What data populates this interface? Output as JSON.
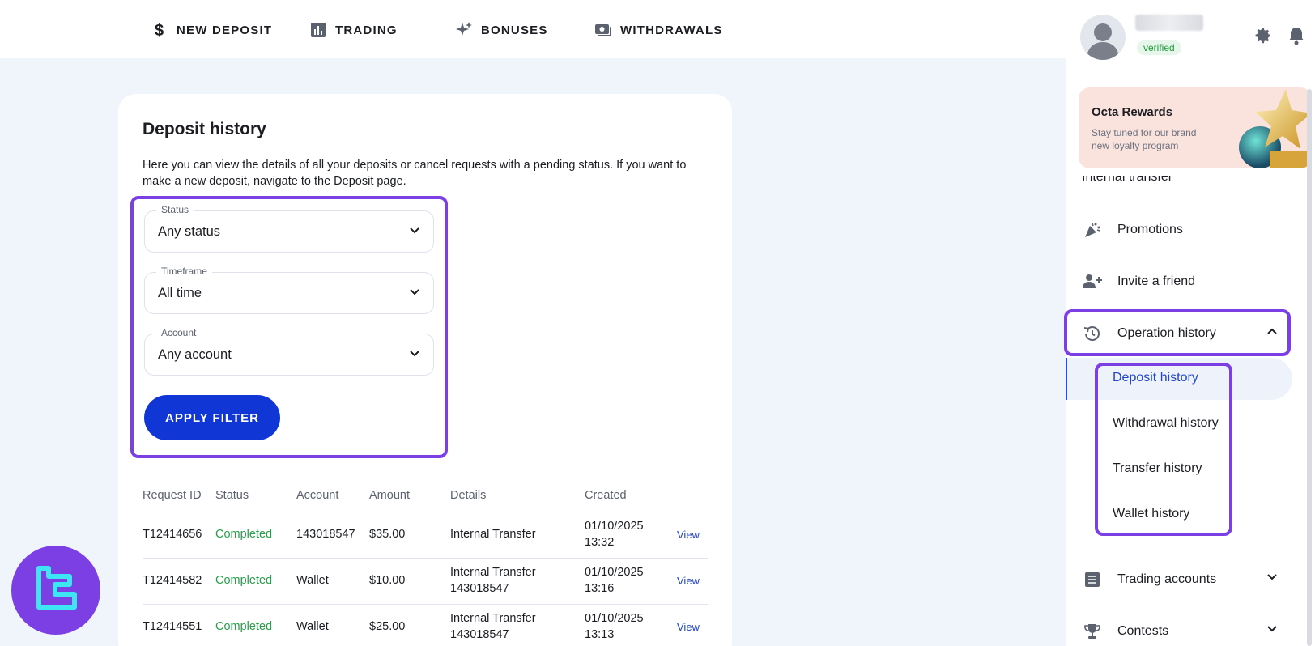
{
  "nav": {
    "items": [
      {
        "label": "NEW DEPOSIT",
        "icon": "dollar-icon"
      },
      {
        "label": "TRADING",
        "icon": "chart-icon"
      },
      {
        "label": "BONUSES",
        "icon": "sparkle-icon"
      },
      {
        "label": "WITHDRAWALS",
        "icon": "cash-icon"
      }
    ]
  },
  "profile": {
    "verified_label": "verified"
  },
  "rewards": {
    "title": "Octa Rewards",
    "subtitle": "Stay tuned for our brand new loyalty program"
  },
  "sidebar": {
    "partial_item": "Internal transfer",
    "items": [
      {
        "label": "Promotions",
        "icon": "party-icon"
      },
      {
        "label": "Invite a friend",
        "icon": "add-user-icon"
      },
      {
        "label": "Operation history",
        "icon": "history-icon"
      },
      {
        "label": "Trading accounts",
        "icon": "list-icon"
      },
      {
        "label": "Contests",
        "icon": "trophy-icon"
      }
    ],
    "sub_items": [
      {
        "label": "Deposit history",
        "active": true
      },
      {
        "label": "Withdrawal history"
      },
      {
        "label": "Transfer history"
      },
      {
        "label": "Wallet history"
      }
    ]
  },
  "page": {
    "title": "Deposit history",
    "description": "Here you can view the details of all your deposits or cancel requests with a pending status. If you want to make a new deposit, navigate to the Deposit page."
  },
  "filters": {
    "status": {
      "label": "Status",
      "value": "Any status"
    },
    "timeframe": {
      "label": "Timeframe",
      "value": "All time"
    },
    "account": {
      "label": "Account",
      "value": "Any account"
    },
    "apply_label": "APPLY FILTER"
  },
  "table": {
    "columns": [
      "Request ID",
      "Status",
      "Account",
      "Amount",
      "Details",
      "Created"
    ],
    "rows": [
      {
        "id": "T12414656",
        "status": "Completed",
        "account": "143018547",
        "amount": "$35.00",
        "details_1": "Internal Transfer",
        "details_2": "",
        "date": "01/10/2025",
        "time": "13:32",
        "action": "View"
      },
      {
        "id": "T12414582",
        "status": "Completed",
        "account": "Wallet",
        "amount": "$10.00",
        "details_1": "Internal Transfer",
        "details_2": "143018547",
        "date": "01/10/2025",
        "time": "13:16",
        "action": "View"
      },
      {
        "id": "T12414551",
        "status": "Completed",
        "account": "Wallet",
        "amount": "$25.00",
        "details_1": "Internal Transfer",
        "details_2": "143018547",
        "date": "01/10/2025",
        "time": "13:13",
        "action": "View"
      }
    ]
  },
  "colors": {
    "accent": "#1136d6",
    "highlight": "#7b3fe4",
    "status_completed": "#25a04a"
  }
}
